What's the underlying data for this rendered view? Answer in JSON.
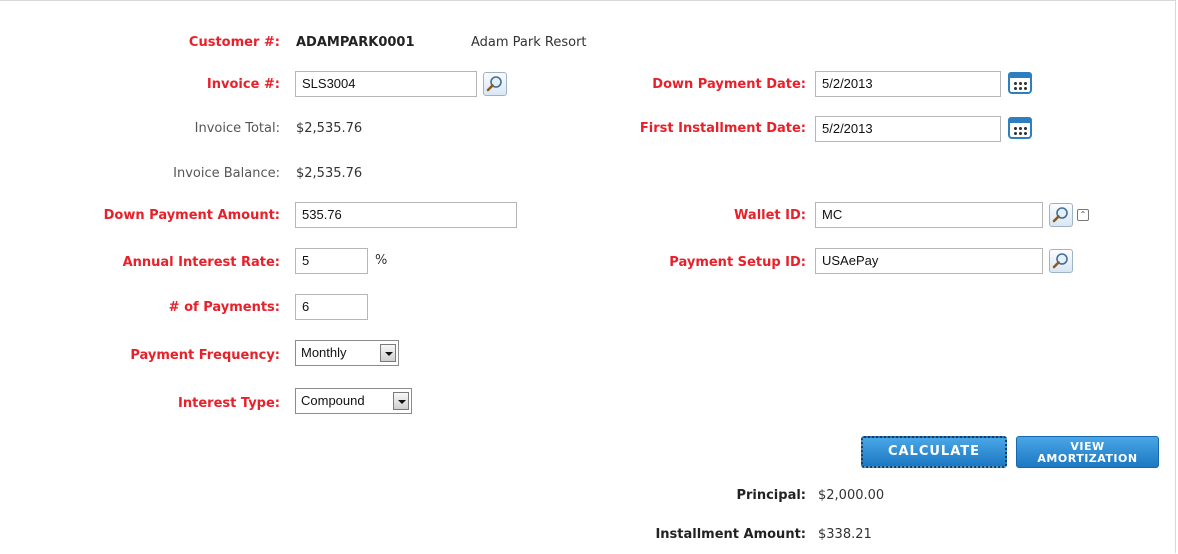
{
  "customer": {
    "label": "Customer #:",
    "number": "ADAMPARK0001",
    "name": "Adam Park Resort"
  },
  "invoice": {
    "label": "Invoice #:",
    "value": "SLS3004"
  },
  "invoice_total": {
    "label": "Invoice Total:",
    "value": "$2,535.76"
  },
  "invoice_balance": {
    "label": "Invoice Balance:",
    "value": "$2,535.76"
  },
  "down_payment_amount": {
    "label": "Down Payment Amount:",
    "value": "535.76"
  },
  "annual_interest_rate": {
    "label": "Annual Interest Rate:",
    "value": "5",
    "unit": "%"
  },
  "num_payments": {
    "label": "# of Payments:",
    "value": "6"
  },
  "payment_frequency": {
    "label": "Payment Frequency:",
    "value": "Monthly"
  },
  "interest_type": {
    "label": "Interest Type:",
    "value": "Compound"
  },
  "down_payment_date": {
    "label": "Down Payment Date:",
    "value": "5/2/2013"
  },
  "first_installment_date": {
    "label": "First Installment Date:",
    "value": "5/2/2013"
  },
  "wallet_id": {
    "label": "Wallet ID:",
    "value": "MC"
  },
  "payment_setup_id": {
    "label": "Payment Setup ID:",
    "value": "USAePay"
  },
  "buttons": {
    "calculate": "CALCULATE",
    "view_line1": "VIEW",
    "view_line2": "AMORTIZATION"
  },
  "results": {
    "principal_label": "Principal:",
    "principal_value": "$2,000.00",
    "installment_label": "Installment Amount:",
    "installment_value": "$338.21"
  },
  "icons": {
    "search": "magnifier-icon",
    "calendar": "calendar-icon",
    "collapse": "collapse-up-icon"
  },
  "colors": {
    "required_label": "#e8202a",
    "button_blue": "#2a8ad6"
  }
}
